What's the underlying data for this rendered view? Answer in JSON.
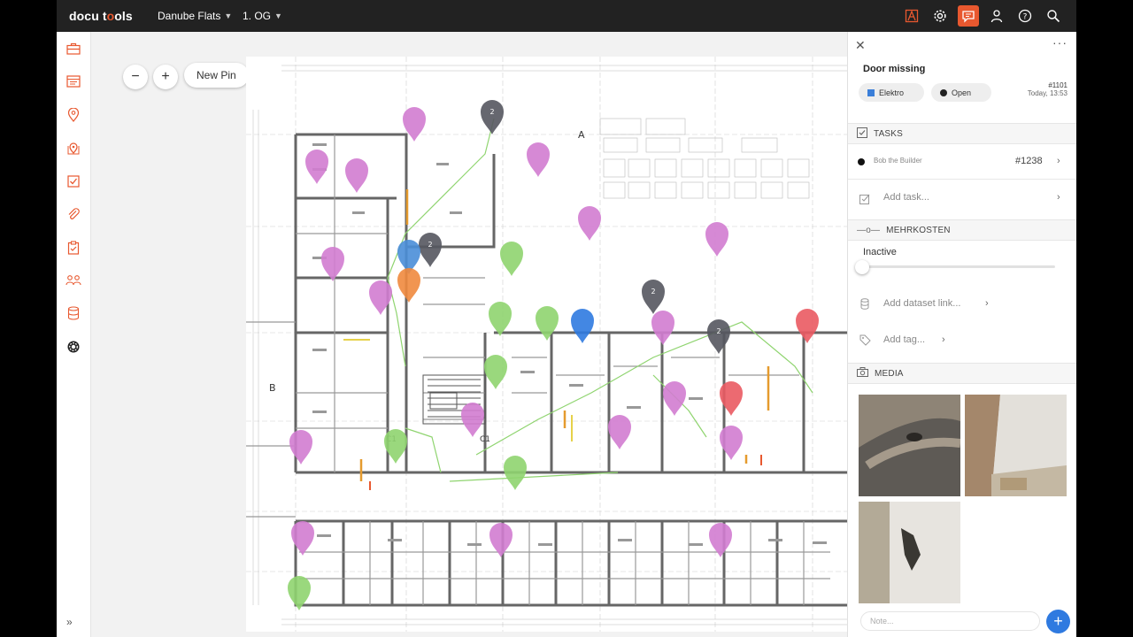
{
  "app": {
    "logo": "docu tools"
  },
  "header": {
    "project": "Danube Flats",
    "level": "1. OG",
    "icons": [
      "plan-icon",
      "gear-icon",
      "chat-icon",
      "user-icon",
      "help-icon",
      "search-icon"
    ]
  },
  "sidebar": {
    "icons": [
      "briefcase-icon",
      "reports-icon",
      "pin-icon",
      "map-pins-icon",
      "task-check-icon",
      "attachment-icon",
      "clipboard-icon",
      "users-icon",
      "database-icon",
      "settings-badge-icon"
    ],
    "expand": "»"
  },
  "toolbar": {
    "zoom_out": "−",
    "zoom_in": "+",
    "new_pin": "New Pin"
  },
  "plan": {
    "labels": {
      "a_top": "A",
      "a_bottom": "A",
      "b": "B",
      "c1_left": "C1",
      "c1_right": "C1"
    },
    "pins": [
      {
        "color": "#d27cd0",
        "count": ""
      },
      {
        "color": "#55565f",
        "count": "2"
      },
      {
        "color": "#d27cd0",
        "count": ""
      },
      {
        "color": "#d27cd0",
        "count": ""
      },
      {
        "color": "#d27cd0",
        "count": ""
      },
      {
        "color": "#d27cd0",
        "count": ""
      },
      {
        "color": "#d27cd0",
        "count": ""
      },
      {
        "color": "#55565f",
        "count": "2"
      },
      {
        "color": "#8fd46f",
        "count": ""
      },
      {
        "color": "#4a8ed8",
        "count": ""
      },
      {
        "color": "#f08a3e",
        "count": ""
      },
      {
        "color": "#d27cd0",
        "count": ""
      },
      {
        "color": "#55565f",
        "count": "2"
      },
      {
        "color": "#d27cd0",
        "count": ""
      },
      {
        "color": "#55565f",
        "count": "2"
      },
      {
        "color": "#8fd46f",
        "count": ""
      },
      {
        "color": "#8fd46f",
        "count": ""
      },
      {
        "color": "#2f7ae0",
        "count": ""
      },
      {
        "color": "#d27cd0",
        "count": ""
      },
      {
        "color": "#ea5a62",
        "count": ""
      },
      {
        "color": "#8fd46f",
        "count": ""
      },
      {
        "color": "#d27cd0",
        "count": ""
      },
      {
        "color": "#ea5a62",
        "count": ""
      },
      {
        "color": "#8fd46f",
        "count": ""
      },
      {
        "color": "#d27cd0",
        "count": ""
      },
      {
        "color": "#d27cd0",
        "count": ""
      },
      {
        "color": "#8fd46f",
        "count": ""
      },
      {
        "color": "#d27cd0",
        "count": ""
      },
      {
        "color": "#d27cd0",
        "count": ""
      },
      {
        "color": "#d27cd0",
        "count": ""
      },
      {
        "color": "#d27cd0",
        "count": ""
      },
      {
        "color": "#d27cd0",
        "count": ""
      },
      {
        "color": "#8fd46f",
        "count": ""
      }
    ]
  },
  "panel": {
    "title": "Door missing",
    "chips": [
      {
        "label": "Elektro",
        "color": "#3b7fd9"
      },
      {
        "label": "Open",
        "color": "#222222"
      }
    ],
    "id": "#1101",
    "timestamp": "Today, 13:53",
    "tasks": {
      "header": "TASKS",
      "items": [
        {
          "assignee": "Bob the Builder",
          "id": "#1238"
        }
      ],
      "add": "Add task..."
    },
    "mehrkosten": {
      "header": "MEHRKOSTEN",
      "status": "Inactive",
      "level": 0,
      "add_dataset": "Add dataset link...",
      "add_tag": "Add tag..."
    },
    "media": {
      "header": "MEDIA"
    },
    "note": {
      "placeholder": "Note..."
    },
    "add_button": "+"
  }
}
